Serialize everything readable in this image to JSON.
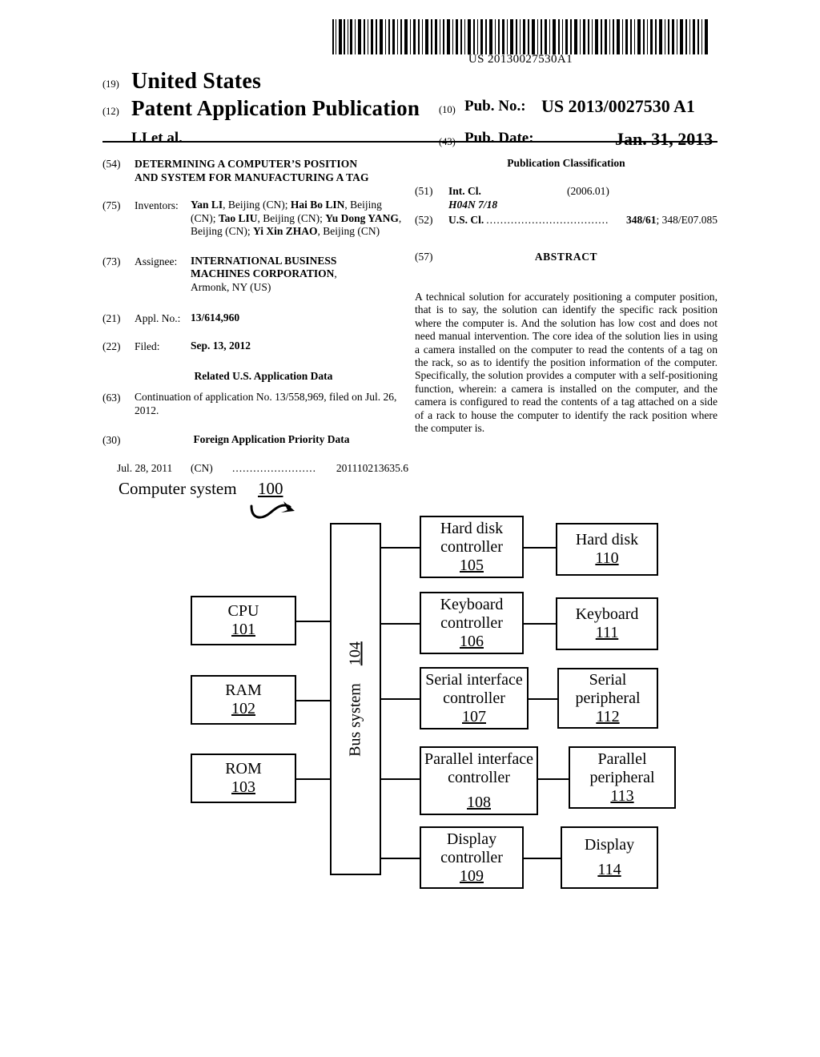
{
  "header": {
    "barcode_number": "US 20130027530A1",
    "country_num": "(19)",
    "country": "United States",
    "doc_type_num": "(12)",
    "doc_type": "Patent Application Publication",
    "applicant_short": "LI et al.",
    "pub_no_num": "(10)",
    "pub_no_label": "Pub. No.:",
    "pub_no_value": "US 2013/0027530 A1",
    "pub_date_num": "(43)",
    "pub_date_label": "Pub. Date:",
    "pub_date_value": "Jan. 31, 2013"
  },
  "left_column": {
    "title_num": "(54)",
    "title_line1": "DETERMINING A COMPUTER’S POSITION",
    "title_line2": "AND SYSTEM FOR MANUFACTURING A TAG",
    "inventors_num": "(75)",
    "inventors_label": "Inventors:",
    "inventors_text": "Yan LI, Beijing (CN); Hai Bo LIN, Beijing (CN); Tao LIU, Beijing (CN); Yu Dong YANG, Beijing (CN); Yi Xin ZHAO, Beijing (CN)",
    "assignee_num": "(73)",
    "assignee_label": "Assignee:",
    "assignee_name": "INTERNATIONAL BUSINESS MACHINES CORPORATION",
    "assignee_city": "Armonk, NY (US)",
    "appl_no_num": "(21)",
    "appl_no_label": "Appl. No.:",
    "appl_no_value": "13/614,960",
    "filed_num": "(22)",
    "filed_label": "Filed:",
    "filed_value": "Sep. 13, 2012",
    "related_head": "Related U.S. Application Data",
    "related_num": "(63)",
    "related_text": "Continuation of application No. 13/558,969, filed on Jul. 26, 2012.",
    "foreign_num": "(30)",
    "foreign_head": "Foreign Application Priority Data",
    "priority_date": "Jul. 28, 2011",
    "priority_country": "(CN)",
    "priority_number": "201110213635.6"
  },
  "right_column": {
    "pub_class_head": "Publication Classification",
    "int_cl_num": "(51)",
    "int_cl_label": "Int. Cl.",
    "int_cl_code": "H04N 7/18",
    "int_cl_version": "(2006.01)",
    "us_cl_num": "(52)",
    "us_cl_label": "U.S. Cl.",
    "us_cl_primary": "348/61",
    "us_cl_secondary": "; 348/E07.085",
    "abstract_num": "(57)",
    "abstract_title": "ABSTRACT",
    "abstract_text": "A technical solution for accurately positioning a computer position, that is to say, the solution can identify the specific rack position where the computer is. And the solution has low cost and does not need manual intervention. The core idea of the solution lies in using a camera installed on the computer to read the contents of a tag on the rack, so as to identify the position information of the computer. Specifically, the solution provides a computer with a self-positioning function, wherein: a camera is installed on the computer, and the camera is configured to read the contents of a tag attached on a side of a rack to house the computer to identify the rack position where the computer is."
  },
  "figure": {
    "title": "Computer system",
    "ref": "100",
    "bus": {
      "label": "Bus system",
      "num": "104"
    },
    "left_blocks": [
      {
        "label": "CPU",
        "num": "101"
      },
      {
        "label": "RAM",
        "num": "102"
      },
      {
        "label": "ROM",
        "num": "103"
      }
    ],
    "controllers": [
      {
        "line1": "Hard disk",
        "line2": "controller",
        "num": "105"
      },
      {
        "line1": "Keyboard",
        "line2": "controller",
        "num": "106"
      },
      {
        "line1": "Serial interface",
        "line2": "controller",
        "num": "107"
      },
      {
        "line1": "Parallel interface",
        "line2": "controller",
        "num": "108"
      },
      {
        "line1": "Display",
        "line2": "controller",
        "num": "109"
      }
    ],
    "devices": [
      {
        "line1": "Hard disk",
        "line2": "",
        "num": "110"
      },
      {
        "line1": "Keyboard",
        "line2": "",
        "num": "111"
      },
      {
        "line1": "Serial",
        "line2": "peripheral",
        "num": "112"
      },
      {
        "line1": "Parallel",
        "line2": "peripheral",
        "num": "113"
      },
      {
        "line1": "Display",
        "line2": "",
        "num": "114"
      }
    ]
  }
}
